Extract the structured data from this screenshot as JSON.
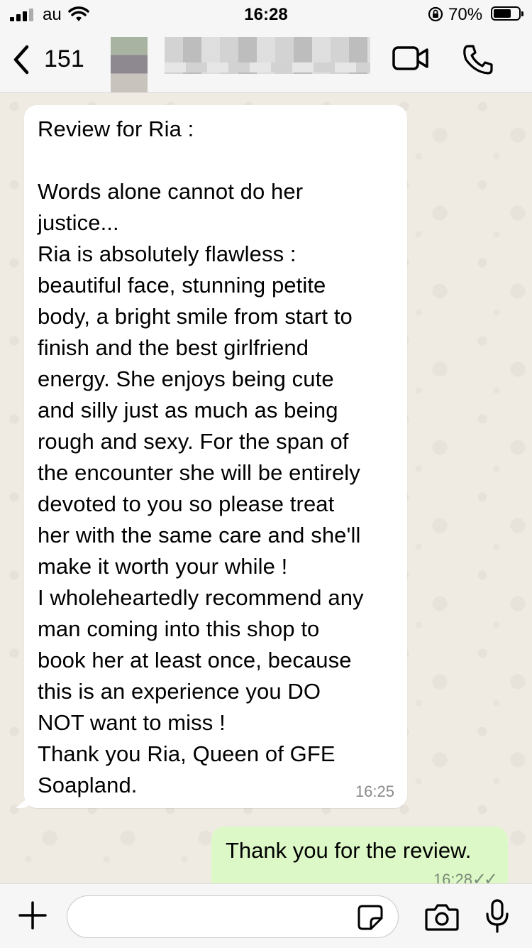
{
  "status_bar": {
    "carrier": "au",
    "time": "16:28",
    "battery_percent": "70%",
    "battery_level": 0.7,
    "icons": [
      "signal-icon",
      "wifi-icon",
      "orientation-lock-icon",
      "battery-icon"
    ]
  },
  "header": {
    "back_count": "151",
    "contact_name": "",
    "icons": [
      "back-chevron-icon",
      "video-call-icon",
      "phone-icon"
    ]
  },
  "messages": [
    {
      "direction": "incoming",
      "text": "Review for Ria :\n\nWords alone cannot do her\njustice...\nRia is absolutely flawless :\nbeautiful face, stunning petite\nbody, a bright smile from start to\nfinish and the best girlfriend\nenergy. She enjoys being cute\nand silly just as much as being\nrough and sexy. For the span of\nthe encounter she will be entirely\ndevoted to you so please treat\nher with the same care and she'll\nmake it worth your while !\nI wholeheartedly recommend any\nman coming into this shop to\nbook her at least once, because\nthis is an experience you DO\nNOT want to miss !\nThank you Ria, Queen of GFE\nSoapland.",
      "time": "16:25"
    },
    {
      "direction": "outgoing",
      "text": "Thank you for the review.",
      "time": "16:28",
      "status": "read"
    }
  ],
  "composer": {
    "placeholder": "",
    "icons": [
      "plus-icon",
      "sticker-icon",
      "camera-icon",
      "microphone-icon"
    ]
  },
  "colors": {
    "incoming_bubble": "#ffffff",
    "outgoing_bubble": "#dcf8c6",
    "chat_background": "#efeae2",
    "bar_background": "#f6f6f6"
  }
}
